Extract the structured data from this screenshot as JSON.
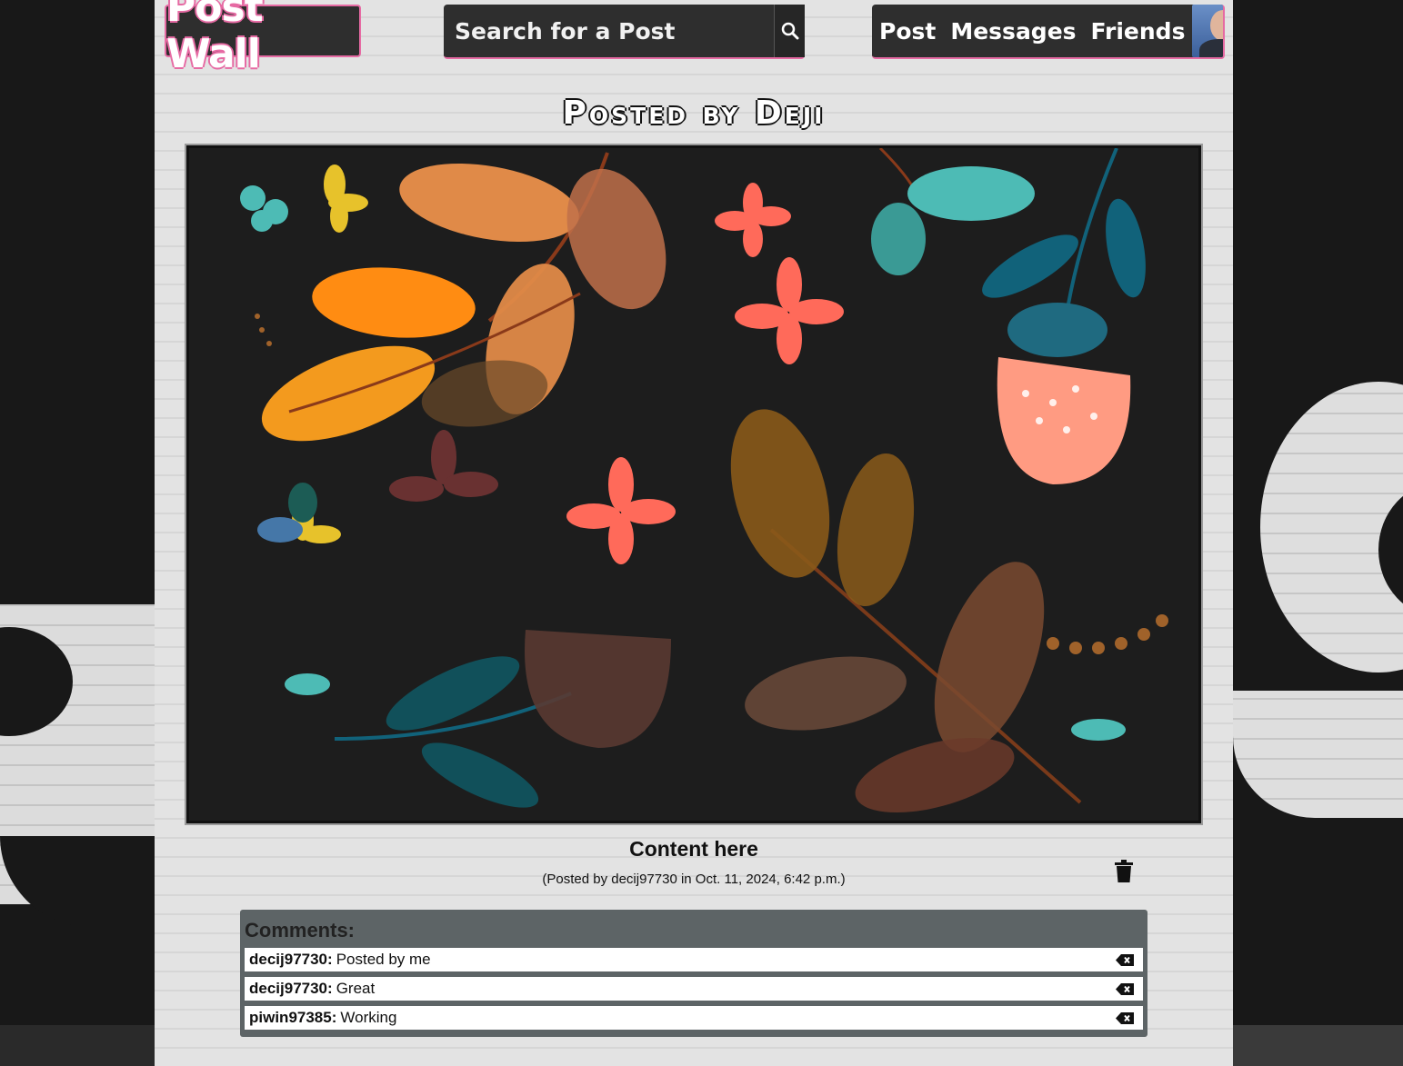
{
  "header": {
    "logo": "Post Wall",
    "search_placeholder": "Search for a Post",
    "search_icon": "search-icon",
    "nav": {
      "post": "Post",
      "messages": "Messages",
      "friends": "Friends"
    },
    "avatar_icon": "avatar"
  },
  "post": {
    "title": "Posted by Deji",
    "content": "Content here",
    "meta": "(Posted by decij97730 in Oct. 11, 2024, 6:42 p.m.)",
    "delete_icon": "trash-icon"
  },
  "comments": {
    "heading": "Comments:",
    "items": [
      {
        "user": "decij97730:",
        "text": "Posted by me"
      },
      {
        "user": "decij97730:",
        "text": "Great"
      },
      {
        "user": "piwin97385:",
        "text": "Working"
      }
    ],
    "delete_icon": "backspace-icon"
  },
  "colors": {
    "accent": "#e66aa3",
    "panel": "#2e2e2e",
    "comments_bg": "#5d6466"
  }
}
